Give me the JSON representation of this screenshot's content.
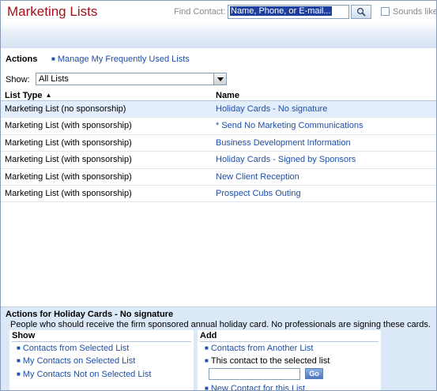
{
  "header": {
    "title": "Marketing Lists",
    "find_label": "Find Contact:",
    "find_value": "Name, Phone, or E-mail...",
    "sounds_like_label": "Sounds like",
    "sounds_like_checked": false
  },
  "actions": {
    "label": "Actions",
    "manage_link": "Manage My Frequently Used Lists"
  },
  "filter": {
    "show_label": "Show:",
    "selected": "All Lists"
  },
  "table": {
    "col_type": "List Type",
    "col_name": "Name",
    "sorted_column": "List Type",
    "sort_direction": "ascending",
    "rows": [
      {
        "type": "Marketing List (no sponsorship)",
        "name": "Holiday Cards - No signature",
        "selected": true
      },
      {
        "type": "Marketing List (with sponsorship)",
        "name": "* Send No Marketing Communications",
        "selected": false
      },
      {
        "type": "Marketing List (with sponsorship)",
        "name": "Business Development Information",
        "selected": false
      },
      {
        "type": "Marketing List (with sponsorship)",
        "name": "Holiday Cards - Signed by Sponsors",
        "selected": false
      },
      {
        "type": "Marketing List (with sponsorship)",
        "name": "New Client Reception",
        "selected": false
      },
      {
        "type": "Marketing List (with sponsorship)",
        "name": "Prospect Cubs Outing",
        "selected": false
      }
    ]
  },
  "panel": {
    "title": "Actions for Holiday Cards - No signature",
    "description": "People who should receive the firm sponsored annual holiday card. No professionals are signing these cards.",
    "show": {
      "title": "Show",
      "items": [
        "Contacts from Selected List",
        "My Contacts on Selected List",
        "My Contacts Not on Selected List"
      ]
    },
    "add": {
      "title": "Add",
      "contacts_link": "Contacts from Another List",
      "contact_text": "This contact to the selected list",
      "go_label": "Go",
      "new_contact_link": "New Contact for this List"
    }
  },
  "colors": {
    "title": "#a2111b",
    "link": "#1f4ea8",
    "selected_row": "#e3eefc",
    "panel_bg": "#dbe8f7"
  }
}
